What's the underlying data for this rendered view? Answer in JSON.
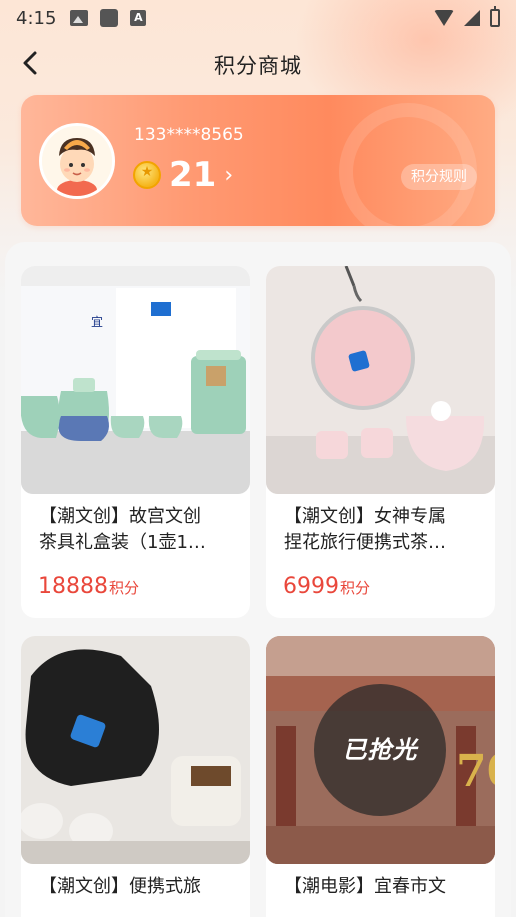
{
  "status_bar": {
    "time": "4:15",
    "a_icon_label": "A"
  },
  "header": {
    "title": "积分商城"
  },
  "user": {
    "phone": "133****8565",
    "points": "21",
    "rules_label": "积分规则"
  },
  "products": [
    {
      "title": "【潮文创】故宫文创\n茶具礼盒装（1壶1…",
      "price": "18888",
      "unit": "积分"
    },
    {
      "title": "【潮文创】女神专属\n捏花旅行便携式茶…",
      "price": "6999",
      "unit": "积分"
    },
    {
      "title": "【潮文创】便携式旅",
      "price": "",
      "unit": ""
    },
    {
      "title": "【潮电影】宜春市文",
      "price": "",
      "unit": "",
      "badge": "已抢光"
    }
  ],
  "colors": {
    "accent": "#ff8a5e",
    "price": "#e9473b"
  },
  "icons": [
    "back-arrow-icon",
    "coin-icon",
    "chevron-right-icon",
    "wifi-icon",
    "signal-icon",
    "battery-icon"
  ]
}
